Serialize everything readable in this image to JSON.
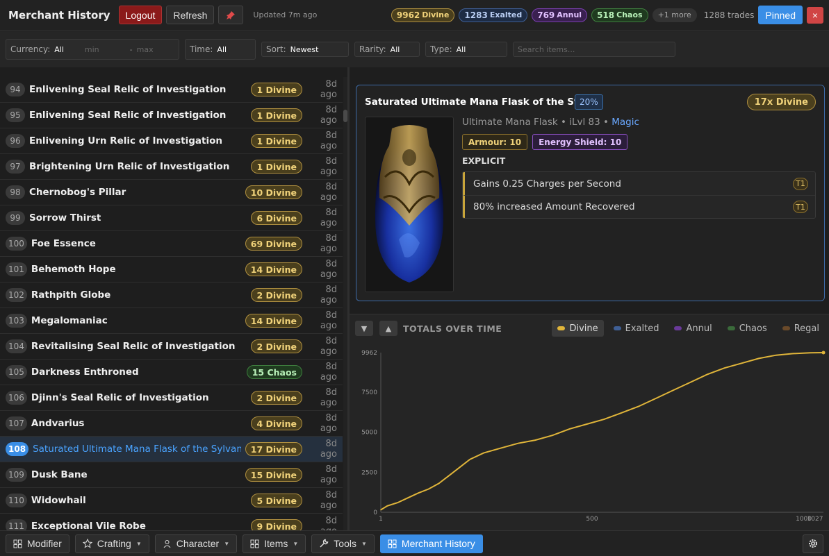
{
  "header": {
    "title": "Merchant History",
    "logout": "Logout",
    "refresh": "Refresh",
    "pin_icon": "pin-icon",
    "updated": "Updated 7m ago",
    "chips": [
      {
        "n": "9962",
        "label": "Divine"
      },
      {
        "n": "1283",
        "label": "Exalted"
      },
      {
        "n": "769",
        "label": "Annul"
      },
      {
        "n": "518",
        "label": "Chaos"
      }
    ],
    "more": "+1 more",
    "trades": "1288 trades",
    "pinned": "Pinned",
    "close": "×"
  },
  "filters": {
    "currency_label": "Currency:",
    "currency_value": "All",
    "min": "min",
    "dash": "-",
    "max": "max",
    "time_label": "Time:",
    "time_value": "All",
    "sort_label": "Sort:",
    "sort_value": "Newest",
    "rarity_label": "Rarity:",
    "rarity_value": "All",
    "type_label": "Type:",
    "type_value": "All",
    "search_placeholder": "Search items..."
  },
  "list": [
    {
      "idx": "94",
      "name": "Enlivening Seal Relic of Investigation",
      "price": "1 Divine",
      "cur": "d",
      "ago": "8d ago"
    },
    {
      "idx": "95",
      "name": "Enlivening Seal Relic of Investigation",
      "price": "1 Divine",
      "cur": "d",
      "ago": "8d ago"
    },
    {
      "idx": "96",
      "name": "Enlivening Urn Relic of Investigation",
      "price": "1 Divine",
      "cur": "d",
      "ago": "8d ago"
    },
    {
      "idx": "97",
      "name": "Brightening Urn Relic of Investigation",
      "price": "1 Divine",
      "cur": "d",
      "ago": "8d ago"
    },
    {
      "idx": "98",
      "name": "Chernobog's Pillar",
      "price": "10 Divine",
      "cur": "d",
      "ago": "8d ago"
    },
    {
      "idx": "99",
      "name": "Sorrow Thirst",
      "price": "6 Divine",
      "cur": "d",
      "ago": "8d ago"
    },
    {
      "idx": "100",
      "name": "Foe Essence",
      "price": "69 Divine",
      "cur": "d",
      "ago": "8d ago"
    },
    {
      "idx": "101",
      "name": "Behemoth Hope",
      "price": "14 Divine",
      "cur": "d",
      "ago": "8d ago"
    },
    {
      "idx": "102",
      "name": "Rathpith Globe",
      "price": "2 Divine",
      "cur": "d",
      "ago": "8d ago"
    },
    {
      "idx": "103",
      "name": "Megalomaniac",
      "price": "14 Divine",
      "cur": "d",
      "ago": "8d ago"
    },
    {
      "idx": "104",
      "name": "Revitalising Seal Relic of Investigation",
      "price": "2 Divine",
      "cur": "d",
      "ago": "8d ago"
    },
    {
      "idx": "105",
      "name": "Darkness Enthroned",
      "price": "15 Chaos",
      "cur": "c",
      "ago": "8d ago"
    },
    {
      "idx": "106",
      "name": "Djinn's Seal Relic of Investigation",
      "price": "2 Divine",
      "cur": "d",
      "ago": "8d ago"
    },
    {
      "idx": "107",
      "name": "Andvarius",
      "price": "4 Divine",
      "cur": "d",
      "ago": "8d ago"
    },
    {
      "idx": "108",
      "name": "Saturated Ultimate Mana Flask of the Sylvan",
      "price": "17 Divine",
      "cur": "d",
      "ago": "8d ago",
      "selected": true
    },
    {
      "idx": "109",
      "name": "Dusk Bane",
      "price": "15 Divine",
      "cur": "d",
      "ago": "8d ago"
    },
    {
      "idx": "110",
      "name": "Widowhail",
      "price": "5 Divine",
      "cur": "d",
      "ago": "8d ago"
    },
    {
      "idx": "111",
      "name": "Exceptional Vile Robe",
      "price": "9 Divine",
      "cur": "d",
      "ago": "8d ago"
    }
  ],
  "detail": {
    "name": "Saturated Ultimate Mana Flask of the Sylvan",
    "quality": "20%",
    "price": "17x Divine",
    "base": "Ultimate Mana Flask",
    "sep1": " • ",
    "ilvl": "iLvl 83",
    "sep2": " • ",
    "rarity": "Magic",
    "armour": "Armour: 10",
    "es": "Energy Shield: 10",
    "explicit_heading": "EXPLICIT",
    "mods": [
      {
        "text": "Gains 0.25 Charges per Second",
        "tier": "T1"
      },
      {
        "text": "80% increased Amount Recovered",
        "tier": "T1"
      }
    ]
  },
  "graph": {
    "title": "TOTALS OVER TIME",
    "legend": [
      {
        "name": "Divine",
        "color": "#e0b53a",
        "active": true
      },
      {
        "name": "Exalted",
        "color": "#3f5f95",
        "active": false
      },
      {
        "name": "Annul",
        "color": "#6a3a9a",
        "active": false
      },
      {
        "name": "Chaos",
        "color": "#3a6a3a",
        "active": false
      },
      {
        "name": "Regal",
        "color": "#6a4a2a",
        "active": false
      }
    ]
  },
  "chart_data": {
    "type": "line",
    "title": "TOTALS OVER TIME",
    "xlabel": "",
    "ylabel": "",
    "xlim": [
      1,
      1027
    ],
    "ylim": [
      0,
      9962
    ],
    "x_ticks": [
      "1",
      "500",
      "1000",
      "1027"
    ],
    "y_ticks": [
      "0",
      "2500",
      "5000",
      "7500",
      "9962"
    ],
    "series": [
      {
        "name": "Divine",
        "color": "#e0b53a",
        "x": [
          1,
          20,
          50,
          80,
          110,
          140,
          170,
          200,
          230,
          260,
          300,
          350,
          400,
          450,
          500,
          550,
          600,
          650,
          700,
          750,
          800,
          850,
          900,
          950,
          1000,
          1050,
          1100,
          1150,
          1200,
          1250,
          1288
        ],
        "y": [
          150,
          400,
          600,
          900,
          1200,
          1450,
          1800,
          2300,
          2800,
          3300,
          3700,
          4000,
          4300,
          4500,
          4800,
          5200,
          5500,
          5800,
          6200,
          6600,
          7100,
          7600,
          8100,
          8600,
          9000,
          9300,
          9600,
          9800,
          9900,
          9950,
          9962
        ]
      }
    ],
    "grid": false
  },
  "bottom": {
    "tabs": [
      {
        "icon": "grid-icon",
        "label": "Modifier",
        "caret": false
      },
      {
        "icon": "star-icon",
        "label": "Crafting",
        "caret": true
      },
      {
        "icon": "user-icon",
        "label": "Character",
        "caret": true
      },
      {
        "icon": "grid-icon",
        "label": "Items",
        "caret": true
      },
      {
        "icon": "wrench-icon",
        "label": "Tools",
        "caret": true
      },
      {
        "icon": "grid-icon",
        "label": "Merchant History",
        "caret": false,
        "active": true
      }
    ],
    "caret": "▼",
    "settings_icon": "gear-icon"
  }
}
